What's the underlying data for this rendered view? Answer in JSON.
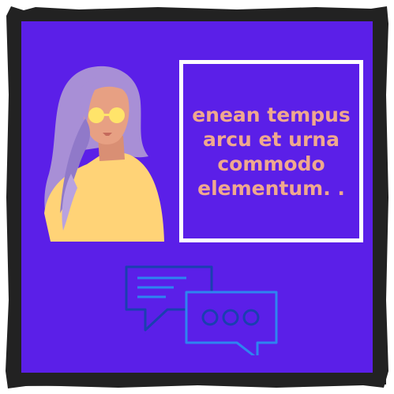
{
  "quote": {
    "text": "enean tempus arcu et urna commodo elementum. ."
  },
  "illustration": {
    "subject": "woman-with-glasses-icon",
    "icon": "chat-bubbles-icon"
  },
  "colors": {
    "background": "#5b1fe8",
    "frame": "#222222",
    "quote_border": "#ffffff",
    "quote_text": "#f0a88e",
    "hair": "#a88fd6",
    "skin": "#e7a083",
    "sweater": "#ffd377",
    "glasses": "#ffe46a",
    "chat_dark": "#1a3fb0",
    "chat_light": "#2e84f0"
  }
}
